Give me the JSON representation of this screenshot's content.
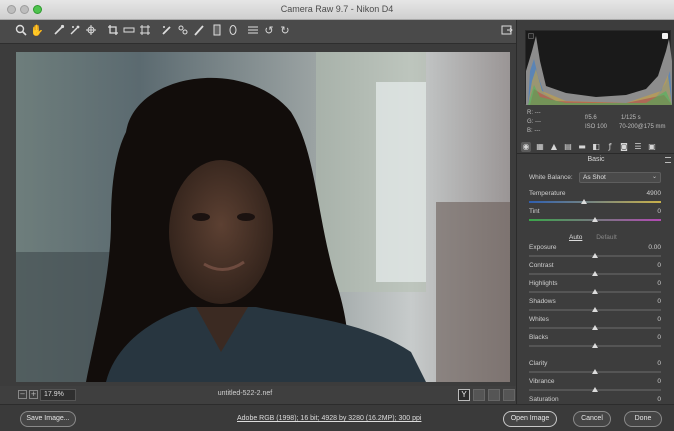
{
  "window": {
    "title": "Camera Raw 9.7  -  Nikon D4"
  },
  "toolbar": {
    "icons": [
      "zoom-icon",
      "hand-icon",
      "white-balance-icon",
      "color-sampler-icon",
      "targeted-adjust-icon",
      "crop-icon",
      "straighten-icon",
      "transform-icon",
      "spot-removal-icon",
      "red-eye-icon",
      "adjustment-brush-icon",
      "graduated-filter-icon",
      "radial-filter-icon",
      "preferences-icon",
      "rotate-left-icon",
      "rotate-right-icon",
      "fullscreen-icon"
    ]
  },
  "histogram": {
    "readout": {
      "r_label": "R:",
      "r_value": "---",
      "g_label": "G:",
      "g_value": "---",
      "b_label": "B:",
      "b_value": "---",
      "aperture": "f/5.6",
      "shutter": "1/125 s",
      "iso": "ISO 100",
      "lens": "70-200@175 mm"
    }
  },
  "panel": {
    "section_title": "Basic",
    "tabs": [
      "basic-tab",
      "tone-curve-tab",
      "detail-tab",
      "hsl-tab",
      "split-toning-tab",
      "lens-corrections-tab",
      "effects-tab",
      "camera-calibration-tab",
      "presets-tab",
      "snapshots-tab"
    ],
    "white_balance": {
      "label": "White Balance:",
      "value": "As Shot"
    },
    "temperature": {
      "label": "Temperature",
      "value": "4900",
      "level": 0.42
    },
    "tint": {
      "label": "Tint",
      "value": "0",
      "level": 0.5
    },
    "auto_label": "Auto",
    "default_label": "Default",
    "sliders": [
      {
        "label": "Exposure",
        "value": "0.00",
        "level": 0.5
      },
      {
        "label": "Contrast",
        "value": "0",
        "level": 0.5
      },
      {
        "label": "Highlights",
        "value": "0",
        "level": 0.5
      },
      {
        "label": "Shadows",
        "value": "0",
        "level": 0.5
      },
      {
        "label": "Whites",
        "value": "0",
        "level": 0.5
      },
      {
        "label": "Blacks",
        "value": "0",
        "level": 0.5
      },
      {
        "label": "Clarity",
        "value": "0",
        "level": 0.5
      },
      {
        "label": "Vibrance",
        "value": "0",
        "level": 0.5
      },
      {
        "label": "Saturation",
        "value": "0",
        "level": 0.5
      }
    ]
  },
  "status": {
    "zoom": "17.9%",
    "filename": "untitled-522-2.nef",
    "y_label": "Y"
  },
  "footer": {
    "save_image": "Save Image...",
    "workflow_link": "Adobe RGB (1998); 16 bit; 4928 by 3280 (16.2MP); 300 ppi",
    "open_image": "Open Image",
    "cancel": "Cancel",
    "done": "Done"
  },
  "colors": {
    "background": "#3c3c3c",
    "panel": "#3d3d3d",
    "accent_slider_thumb": "#dcdcdc"
  }
}
